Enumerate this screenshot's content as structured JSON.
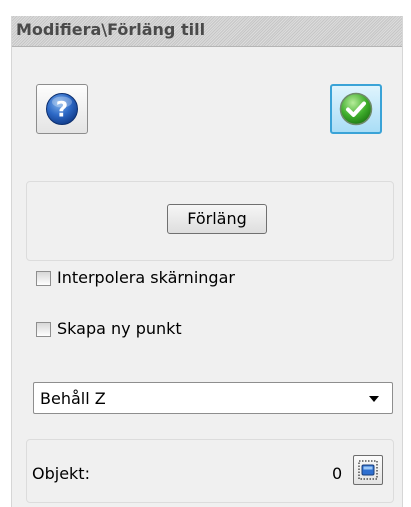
{
  "window": {
    "title": "Modifiera\\Förläng till"
  },
  "toolbar": {
    "help_icon": "question-mark-icon",
    "ok_icon": "green-checkmark-icon"
  },
  "actions": {
    "extend_label": "Förläng"
  },
  "options": {
    "interpolate_label": "Interpolera skärningar",
    "interpolate_checked": false,
    "new_point_label": "Skapa ny punkt",
    "new_point_checked": false
  },
  "z_mode": {
    "selected": "Behåll Z"
  },
  "objects": {
    "label": "Objekt:",
    "count": "0",
    "select_icon": "select-objects-icon"
  }
}
